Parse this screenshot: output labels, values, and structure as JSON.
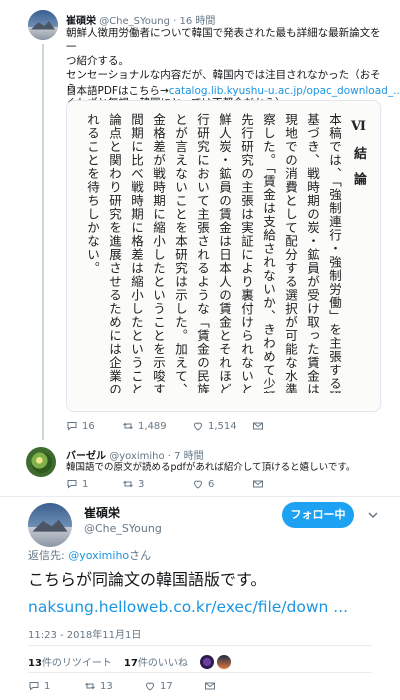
{
  "tweet1": {
    "name": "崔碩栄",
    "handle": "@Che_SYoung",
    "time": "16 時間",
    "text_lines": [
      "朝鮮人徴用労働者について韓国で発表された最も詳細な最新論文を一",
      "つ紹介する。",
      "センセーショナルな内容だが、韓国内では注目されなかった（おそら",
      "くわざと無視。韓国にとっては不都合だから）。"
    ],
    "pdf_prefix": "日本語PDFはこちら→",
    "pdf_link": "catalog.lib.kyushu-u.ac.jp/opac_download_...",
    "image_section_title": "Ⅵ 結 論",
    "image_columns": [
      "本稿では、「強制連行・強制労働」を主張する研究者が刊行",
      "基づき、戦時期の炭・鉱員が受け取った賃金は朝鮮の家族に",
      "現地での消費として配分する選択が可能な水準であったとい",
      "察した。「賃金は支給されないか、きわめて少額に過ぎなかっ",
      "先行研究の主張は実証により裏付けられないということを確",
      "鮮人炭・鉱員の賃金は日本人の賃金とそれほど大きな差はな",
      "行研究において主張されるような「賃金の民族差別」があっ",
      "とが言えないことを本研究は示した。加えて、朝鮮人と日本",
      "金格差が戦時期に縮小したということを示唆する研究と資料",
      "間期に比べ戦時期に格差は縮小したということを示す事例が",
      "論点と関わり研究を進展させるためには企業のレベルでの資",
      "れることを待ちしかない。"
    ],
    "actions": {
      "reply": "16",
      "retweet": "1,489",
      "like": "1,514"
    }
  },
  "tweet2": {
    "name": "バーゼル",
    "handle": "@yoximiho",
    "time": "7 時間",
    "text": "韓国語での原文が読めるpdfがあれば紹介して頂けると嬉しいです。",
    "actions": {
      "reply": "1",
      "retweet": "3",
      "like": "6"
    }
  },
  "tweet3": {
    "name": "崔碩栄",
    "handle": "@Che_SYoung",
    "follow_label": "フォロー中",
    "reply_prefix": "返信先: ",
    "reply_handle": "@yoximiho",
    "reply_suffix": "さん",
    "text": "こちらが同論文の韓国語版です。",
    "link": "naksung.helloweb.co.kr/exec/file/down  ...",
    "timestamp": "11:23 - 2018年11月1日",
    "retweets_count": "13",
    "retweets_label": "件のリツイート",
    "likes_count": "17",
    "likes_label": "件のいいね",
    "actions": {
      "reply": "1",
      "retweet": "13",
      "like": "17"
    }
  },
  "colors": {
    "accent": "#1da1f2",
    "link": "#1b95e0",
    "muted": "#657786",
    "like_icon": "#e0245e"
  }
}
